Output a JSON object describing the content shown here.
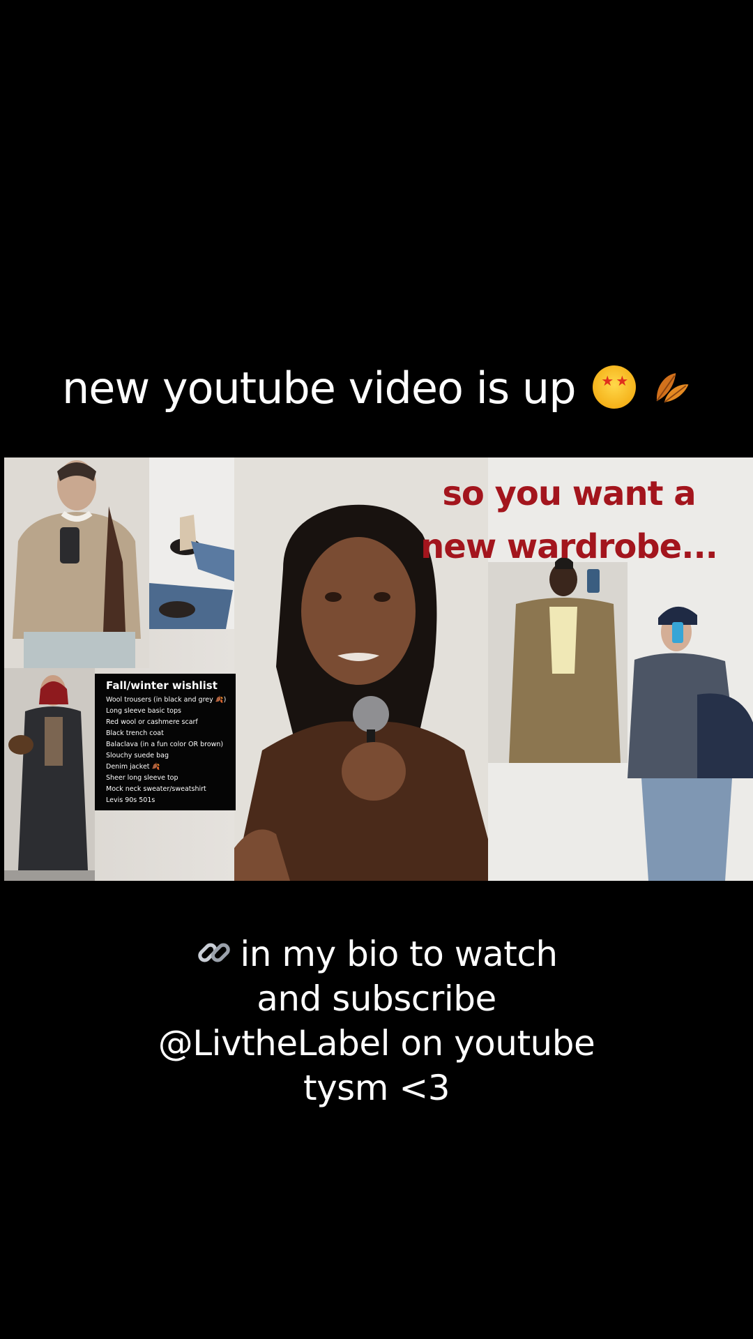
{
  "caption": {
    "top_text": "new youtube video is up",
    "top_emojis": [
      "star-struck-emoji",
      "fallen-leaf-emoji"
    ],
    "bottom_lines": [
      "in my bio to watch",
      "and subscribe",
      "@LivtheLabel on youtube",
      "tysm <3"
    ],
    "bottom_emoji": "link-emoji"
  },
  "thumbnail": {
    "headline_line1": "so you want a",
    "headline_line2": "new wardrobe...",
    "headline_color": "#a3151d",
    "wishlist": {
      "title": "Fall/winter wishlist",
      "items": [
        "Wool trousers (in black and grey 🍂)",
        "Long sleeve basic tops",
        "Red wool or cashmere scarf",
        "Black trench coat",
        "Balaclava (in a fun color OR brown)",
        "Slouchy suede bag",
        "Denim jacket 🍂",
        "Sheer long sleeve top",
        "Mock neck sweater/sweatshirt",
        "Levis 90s 501s"
      ]
    }
  }
}
